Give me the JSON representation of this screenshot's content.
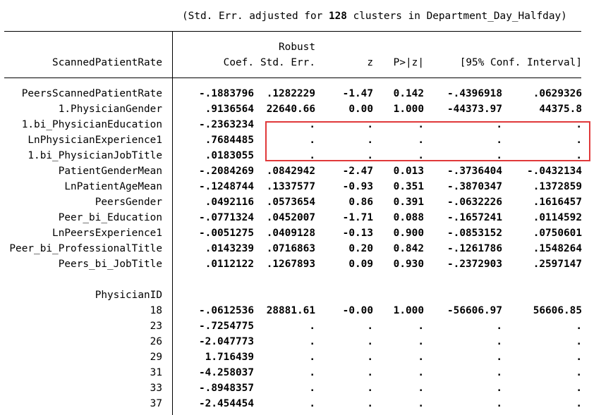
{
  "header": {
    "prefix": "(Std. Err. adjusted for ",
    "clusters": "128",
    "suffix": " clusters in Department_Day_Halfday)"
  },
  "columns": {
    "depvar": "ScannedPatientRate",
    "coef": "Coef.",
    "se_top": "Robust",
    "se": "Std. Err.",
    "z": "z",
    "p": "P>|z|",
    "ci": "[95% Conf. Interval]"
  },
  "rows": [
    {
      "label": "PeersScannedPatientRate",
      "coef": "-.1883796",
      "se": ".1282229",
      "z": "-1.47",
      "p": "0.142",
      "lo": "-.4396918",
      "hi": ".0629326"
    },
    {
      "label": "1.PhysicianGender",
      "coef": ".9136564",
      "se": "22640.66",
      "z": "0.00",
      "p": "1.000",
      "lo": "-44373.97",
      "hi": "44375.8"
    },
    {
      "label": "1.bi_PhysicianEducation",
      "coef": "-.2363234",
      "se": ".",
      "z": ".",
      "p": ".",
      "lo": ".",
      "hi": "."
    },
    {
      "label": "LnPhysicianExperience1",
      "coef": ".7684485",
      "se": ".",
      "z": ".",
      "p": ".",
      "lo": ".",
      "hi": "."
    },
    {
      "label": "1.bi_PhysicianJobTitle",
      "coef": ".0183055",
      "se": ".",
      "z": ".",
      "p": ".",
      "lo": ".",
      "hi": "."
    },
    {
      "label": "PatientGenderMean",
      "coef": "-.2084269",
      "se": ".0842942",
      "z": "-2.47",
      "p": "0.013",
      "lo": "-.3736404",
      "hi": "-.0432134"
    },
    {
      "label": "LnPatientAgeMean",
      "coef": "-.1248744",
      "se": ".1337577",
      "z": "-0.93",
      "p": "0.351",
      "lo": "-.3870347",
      "hi": ".1372859"
    },
    {
      "label": "PeersGender",
      "coef": ".0492116",
      "se": ".0573654",
      "z": "0.86",
      "p": "0.391",
      "lo": "-.0632226",
      "hi": ".1616457"
    },
    {
      "label": "Peer_bi_Education",
      "coef": "-.0771324",
      "se": ".0452007",
      "z": "-1.71",
      "p": "0.088",
      "lo": "-.1657241",
      "hi": ".0114592"
    },
    {
      "label": "LnPeersExperience1",
      "coef": "-.0051275",
      "se": ".0409128",
      "z": "-0.13",
      "p": "0.900",
      "lo": "-.0853152",
      "hi": ".0750601"
    },
    {
      "label": "Peer_bi_ProfessionalTitle",
      "coef": ".0143239",
      "se": ".0716863",
      "z": "0.20",
      "p": "0.842",
      "lo": "-.1261786",
      "hi": ".1548264"
    },
    {
      "label": "Peers_bi_JobTitle",
      "coef": ".0112122",
      "se": ".1267893",
      "z": "0.09",
      "p": "0.930",
      "lo": "-.2372903",
      "hi": ".2597147"
    }
  ],
  "group_label": "PhysicianID",
  "group_rows": [
    {
      "label": "18",
      "coef": "-.0612536",
      "se": "28881.61",
      "z": "-0.00",
      "p": "1.000",
      "lo": "-56606.97",
      "hi": "56606.85"
    },
    {
      "label": "23",
      "coef": "-.7254775",
      "se": ".",
      "z": ".",
      "p": ".",
      "lo": ".",
      "hi": "."
    },
    {
      "label": "26",
      "coef": "-2.047773",
      "se": ".",
      "z": ".",
      "p": ".",
      "lo": ".",
      "hi": "."
    },
    {
      "label": "29",
      "coef": "1.716439",
      "se": ".",
      "z": ".",
      "p": ".",
      "lo": ".",
      "hi": "."
    },
    {
      "label": "31",
      "coef": "-4.258037",
      "se": ".",
      "z": ".",
      "p": ".",
      "lo": ".",
      "hi": "."
    },
    {
      "label": "33",
      "coef": "-.8948357",
      "se": ".",
      "z": ".",
      "p": ".",
      "lo": ".",
      "hi": "."
    },
    {
      "label": "37",
      "coef": "-2.454454",
      "se": ".",
      "z": ".",
      "p": ".",
      "lo": ".",
      "hi": "."
    }
  ],
  "highlight_color": "#e0393a"
}
